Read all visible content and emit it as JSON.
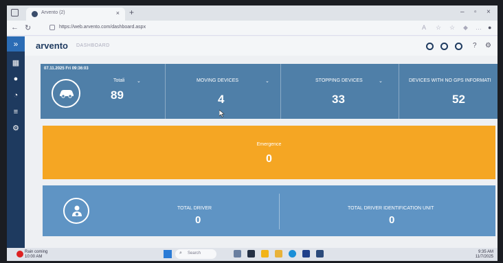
{
  "browser": {
    "tab_title": "Arvento (2)",
    "url": "https://web.arvento.com/dashboard.aspx"
  },
  "app": {
    "logo": "arvento",
    "logo_sub": "DASHBOARD"
  },
  "stats": {
    "timestamp": "07.11.2025 Fri 09:36:03",
    "total_label": "Totali",
    "total_value": "89",
    "moving_label": "MOVING DEVICES",
    "moving_value": "4",
    "stopping_label": "STOPPING DEVICES",
    "stopping_value": "33",
    "nogps_label": "DEVICES WITH NO GPS INFORMATI",
    "nogps_value": "52"
  },
  "emergency": {
    "label": "Emergence",
    "value": "0"
  },
  "driver": {
    "total_driver_label": "TOTAL DRIVER",
    "total_driver_value": "0",
    "total_unit_label": "TOTAL DRIVER IDENTIFICATION UNIT",
    "total_unit_value": "0"
  },
  "taskbar": {
    "weather_line1": "Rain coming",
    "weather_line2": "10:00 AM",
    "search_placeholder": "Search",
    "clock_time": "9:35 AM",
    "clock_date": "11/7/2025"
  },
  "colors": {
    "sidebar": "#1e3a5f",
    "stats_panel": "#4f7fa8",
    "emergency_panel": "#f5a623",
    "driver_panel": "#5f94c4"
  }
}
